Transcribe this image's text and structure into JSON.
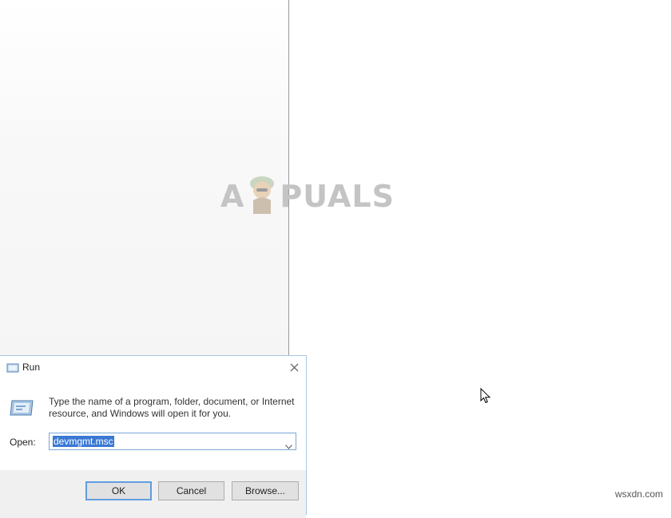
{
  "watermark": {
    "left": "A",
    "right": "PUALS"
  },
  "run_dialog": {
    "title": "Run",
    "description_line1": "Type the name of a program, folder, document, or Internet",
    "description_line2": "resource, and Windows will open it for you.",
    "open_label": "Open:",
    "open_value": "devmgmt.msc",
    "ok_label": "OK",
    "cancel_label": "Cancel",
    "browse_label": "Browse..."
  },
  "site_watermark": "wsxdn.com",
  "colors": {
    "selection": "#3a78d4",
    "focus_border": "#5f9ee0",
    "button_bar": "#f0f0f0"
  }
}
